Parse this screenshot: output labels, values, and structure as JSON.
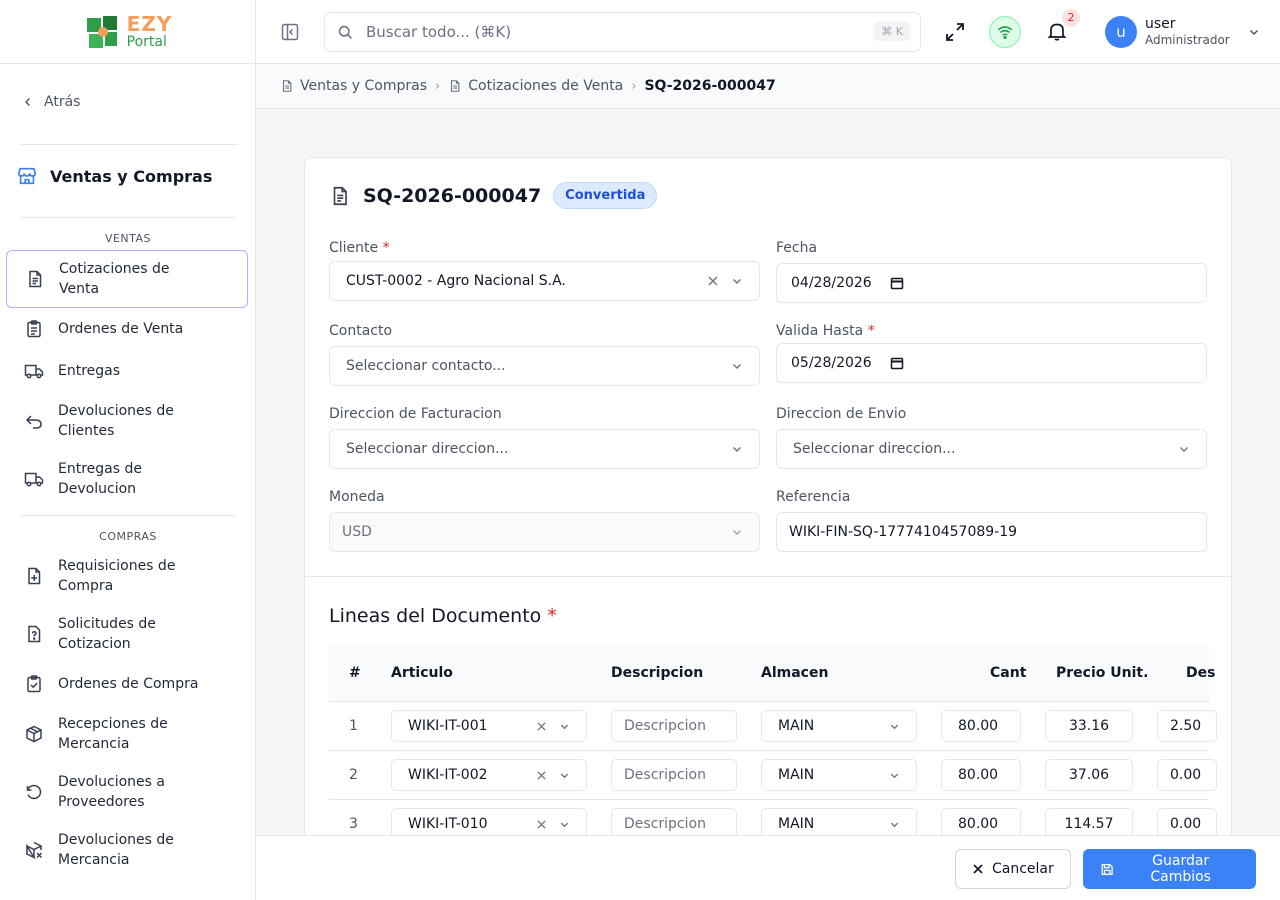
{
  "brand": {
    "line1": "EZY",
    "line2": "Portal"
  },
  "sidebar": {
    "back_label": "Atrás",
    "module_title": "Ventas y Compras",
    "sections": [
      {
        "label": "VENTAS"
      },
      {
        "label": "COMPRAS"
      }
    ],
    "items": [
      {
        "line1": "Cotizaciones de",
        "line2": "Venta",
        "icon": "file-text-icon",
        "active": true
      },
      {
        "line1": "Ordenes de Venta",
        "line2": "",
        "icon": "clipboard-list-icon"
      },
      {
        "line1": "Entregas",
        "line2": "",
        "icon": "truck-icon"
      },
      {
        "line1": "Devoluciones de",
        "line2": "Clientes",
        "icon": "undo-icon"
      },
      {
        "line1": "Entregas de",
        "line2": "Devolucion",
        "icon": "truck-icon"
      },
      {
        "line1": "Requisiciones de",
        "line2": "Compra",
        "icon": "file-plus-icon"
      },
      {
        "line1": "Solicitudes de",
        "line2": "Cotizacion",
        "icon": "file-question-icon"
      },
      {
        "line1": "Ordenes de Compra",
        "line2": "",
        "icon": "clipboard-check-icon"
      },
      {
        "line1": "Recepciones de",
        "line2": "Mercancia",
        "icon": "package-icon"
      },
      {
        "line1": "Devoluciones a",
        "line2": "Proveedores",
        "icon": "rotate-ccw-icon"
      },
      {
        "line1": "Devoluciones de",
        "line2": "Mercancia",
        "icon": "package-x-icon"
      }
    ]
  },
  "header": {
    "search_placeholder": "Buscar todo... (⌘K)",
    "search_shortcut": "⌘ K",
    "notifications_count": "2",
    "user_initial": "u",
    "user_name": "user",
    "user_role": "Administrador"
  },
  "breadcrumb": {
    "items": [
      "Ventas y Compras",
      "Cotizaciones de Venta",
      "SQ-2026-000047"
    ]
  },
  "document": {
    "number": "SQ-2026-000047",
    "status": "Convertida",
    "fields": {
      "cliente_label": "Cliente",
      "cliente_value": "CUST-0002 - Agro Nacional S.A.",
      "fecha_label": "Fecha",
      "fecha_value": "04/28/2026",
      "contacto_label": "Contacto",
      "contacto_placeholder": "Seleccionar contacto...",
      "valida_label": "Valida Hasta",
      "valida_value": "05/28/2026",
      "facturacion_label": "Direccion de Facturacion",
      "facturacion_placeholder": "Seleccionar direccion...",
      "envio_label": "Direccion de Envio",
      "envio_placeholder": "Seleccionar direccion...",
      "moneda_label": "Moneda",
      "moneda_value": "USD",
      "referencia_label": "Referencia",
      "referencia_value": "WIKI-FIN-SQ-1777410457089-19"
    },
    "required_mark": "*"
  },
  "lines": {
    "title": "Lineas del Documento",
    "headers": [
      "#",
      "Articulo",
      "Descripcion",
      "Almacen",
      "Cant",
      "Precio Unit.",
      "Des"
    ],
    "desc_placeholder": "Descripcion",
    "rows": [
      {
        "num": "1",
        "item": "WIKI-IT-001",
        "warehouse": "MAIN",
        "qty": "80.00",
        "price": "33.16",
        "discount": "2.50"
      },
      {
        "num": "2",
        "item": "WIKI-IT-002",
        "warehouse": "MAIN",
        "qty": "80.00",
        "price": "37.06",
        "discount": "0.00"
      },
      {
        "num": "3",
        "item": "WIKI-IT-010",
        "warehouse": "MAIN",
        "qty": "80.00",
        "price": "114.57",
        "discount": "0.00"
      }
    ]
  },
  "footer": {
    "cancel_label": "Cancelar",
    "save_label": "Guardar Cambios"
  },
  "colors": {
    "primary": "#3b82f6",
    "badge_bg": "#dbeafe",
    "required": "#dc2626",
    "logo_orange": "#f59e5b",
    "logo_green": "#2e9e4a"
  }
}
